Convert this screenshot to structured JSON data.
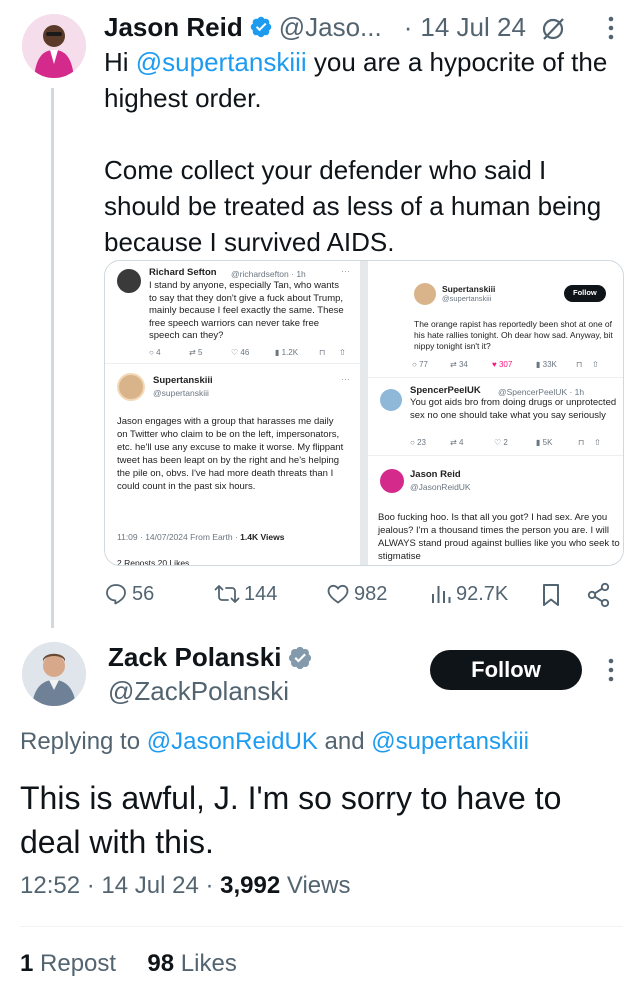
{
  "tweet": {
    "author_name": "Jason Reid",
    "author_handle": "@Jaso...",
    "separator": "·",
    "date": "14 Jul 24",
    "text_prefix": "Hi ",
    "text_mention": "@supertanskiii",
    "text_line1_rest": " you are a hypocrite of the highest order.",
    "text_para2": "Come collect your defender who said I should be treated as less of a human being because I survived AIDS.",
    "actions": {
      "replies": "56",
      "reposts": "144",
      "likes": "982",
      "views": "92.7K"
    }
  },
  "media": {
    "left": {
      "top_name": "Richard Sefton",
      "top_handle": "@richardsefton · 1h",
      "top_text": "I stand by anyone, especially Tan, who wants to say that they don't give a fuck about Trump, mainly because I feel exactly the same. These free speech warriors can never take free speech can they?",
      "top_actions": [
        "4",
        "5",
        "46",
        "1.2K"
      ],
      "main_name": "Supertanskiii",
      "main_handle": "@supertanskiii",
      "main_text": "Jason engages with a group that harasses me daily on Twitter who claim to be on the left, impersonators, etc. he'll use any excuse to make it worse. My flippant tweet has been leapt on by the right and he's helping the pile on, obvs. I've had more death threats than I could count in the past six hours.",
      "main_meta_time": "11:09 · 14/07/2024 From Earth · ",
      "main_meta_views": "1.4K Views",
      "bottom_cut": "2 Reposts  20 Likes"
    },
    "right": {
      "top_name": "Supertanskiii",
      "top_handle": "@supertanskiii",
      "follow_label": "Follow",
      "top_text": "The orange rapist has reportedly been shot at one of his hate rallies tonight. Oh dear how sad. Anyway, bit nippy tonight isn't it?",
      "top_actions": [
        "77",
        "34",
        "307",
        "33K"
      ],
      "mid_name": "SpencerPeelUK",
      "mid_handle": "@SpencerPeelUK · 1h",
      "mid_text": "You got aids bro from doing drugs or unprotected sex no one should take what you say seriously",
      "mid_actions": [
        "23",
        "4",
        "2",
        "5K"
      ],
      "bottom_name": "Jason Reid",
      "bottom_handle": "@JasonReidUK",
      "bottom_text": "Boo fucking hoo. Is that all you got? I had sex. Are you jealous? I'm a thousand times the person you are. I will ALWAYS stand proud against bullies like you who seek to stigmatise"
    }
  },
  "reply": {
    "author_name": "Zack Polanski",
    "author_handle": "@ZackPolanski",
    "follow_label": "Follow",
    "replying_prefix": "Replying to ",
    "replying_to_1": "@JasonReidUK",
    "replying_and": " and ",
    "replying_to_2": "@supertanskiii",
    "text": "This is awful, J. I'm so sorry to have to deal with this.",
    "time": "12:52",
    "date": "14 Jul 24",
    "views_count": "3,992",
    "views_label": " Views",
    "reposts_count": "1",
    "reposts_label": " Repost",
    "likes_count": "98",
    "likes_label": " Likes"
  },
  "colors": {
    "accent": "#1d9bf0",
    "text": "#0f1419",
    "muted": "#536471",
    "like_pink": "#f91880",
    "verified_blue": "#1d9bf0",
    "verified_gray": "#829aab"
  }
}
